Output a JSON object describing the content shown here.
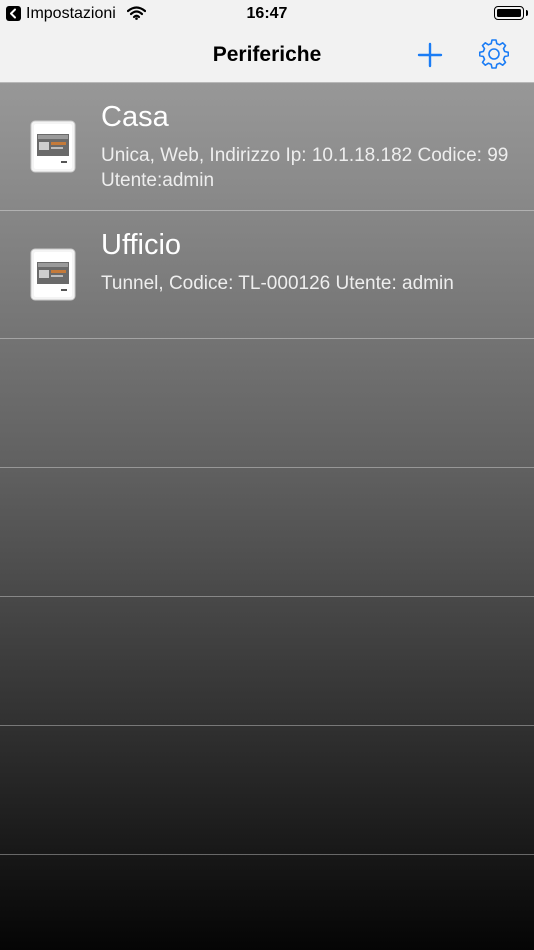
{
  "status_bar": {
    "back_app": "Impostazioni",
    "time": "16:47"
  },
  "navbar": {
    "title": "Periferiche",
    "add_icon": "plus-icon",
    "settings_icon": "gear-icon",
    "accent_color": "#1a7cf5"
  },
  "devices": [
    {
      "name": "Casa",
      "detail": "Unica, Web, Indirizzo Ip: 10.1.18.182 Codice: 99 Utente:admin",
      "icon": "thermostat-device-icon"
    },
    {
      "name": "Ufficio",
      "detail": "Tunnel, Codice: TL-000126 Utente: admin",
      "icon": "thermostat-device-icon"
    }
  ]
}
